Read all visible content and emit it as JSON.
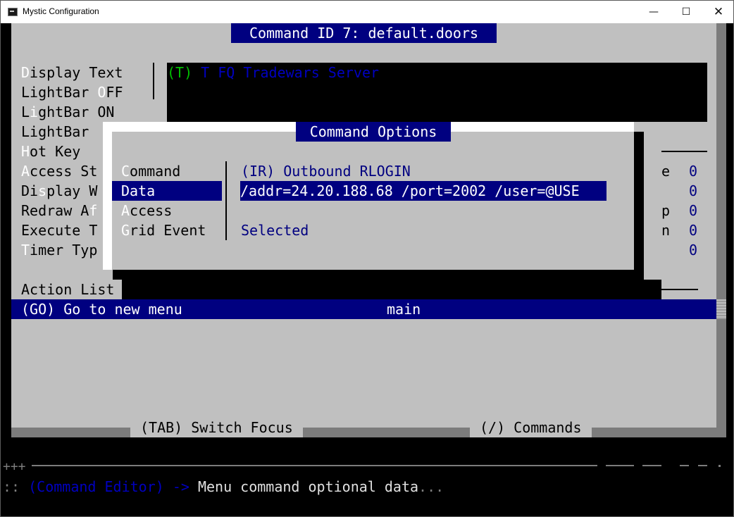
{
  "window": {
    "title": "Mystic Configuration",
    "minimize_glyph": "—",
    "maximize_glyph": "☐",
    "close_glyph": "✕"
  },
  "editor": {
    "header_title": "Command ID 7: default.doors",
    "display_text_prefix": "(T)",
    "display_text_rest": " T FQ Tradewars Server",
    "fields": [
      {
        "hotkey": "D",
        "rest": "isplay Text"
      },
      {
        "pre": "LightBar ",
        "hotkey": "O",
        "rest": "FF"
      },
      {
        "pre": "L",
        "hotkey": "i",
        "rest": "ghtBar ON"
      },
      {
        "pre": "LightBar",
        "hotkey": "",
        "rest": ""
      },
      {
        "hotkey": "H",
        "rest": "ot Key"
      },
      {
        "hotkey": "A",
        "rest": "ccess St"
      },
      {
        "pre": "Di",
        "hotkey": "s",
        "rest": "play W"
      },
      {
        "pre": "Redraw A",
        "hotkey": "f",
        "rest": ""
      },
      {
        "pre": "Execute T",
        "hotkey": "",
        "rest": ""
      },
      {
        "hotkey": "T",
        "rest": "imer Typ"
      }
    ],
    "right_labels": [
      "e",
      "p",
      "n"
    ],
    "right_values": [
      "0",
      "0",
      "0",
      "0",
      "0"
    ],
    "action_list_label": "Action List",
    "action_row": {
      "command": "(GO) Go to new menu",
      "data": "main"
    },
    "footer_tab": "(TAB) Switch Focus",
    "footer_commands": "(/) Commands"
  },
  "dialog": {
    "title": "Command Options",
    "options": [
      {
        "hotkey": "C",
        "rest": "ommand",
        "selected": false
      },
      {
        "hotkey": "D",
        "rest": "ata",
        "selected": true
      },
      {
        "hotkey": "A",
        "rest": "ccess",
        "selected": false
      },
      {
        "hotkey": "G",
        "rest": "rid Event",
        "selected": false
      }
    ],
    "values": {
      "command": "(IR) Outbound RLOGIN",
      "data": "/addr=24.20.188.68 /port=2002 /user=@USE",
      "access": "",
      "grid_event": "Selected"
    }
  },
  "status": {
    "plus": "+++",
    "prefix": ":: ",
    "context": "(Command Editor)",
    "arrow": " -> ",
    "message": "Menu command optional data",
    "ellipsis": "..."
  },
  "colors": {
    "panel_gray": "#c0c0c0",
    "navy": "#000080",
    "bright_blue": "#0000c0",
    "green": "#00c000"
  }
}
